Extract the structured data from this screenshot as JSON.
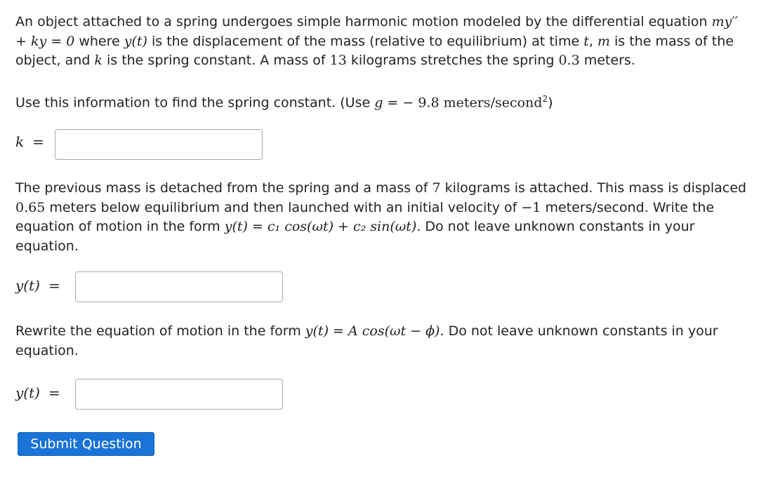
{
  "problem": {
    "intro": {
      "t1": "An object attached to a spring undergoes simple harmonic motion modeled by the differential equation",
      "eq1": "my′′ + ky = 0",
      "t2": " where ",
      "eq2": "y(t)",
      "t3": " is the displacement of the mass (relative to equilibrium) at time ",
      "eq3": "t",
      "t4": ", ",
      "eq4": "m",
      "t5": " is the mass of the object, and ",
      "eq5": "k",
      "t6": " is the spring constant. A mass of ",
      "num1": "13",
      "t7": " kilograms stretches the spring ",
      "num2": "0.3",
      "t8": " meters."
    },
    "part1": {
      "t1": "Use this information to find the spring constant. (Use ",
      "eq": "g",
      "t2": " = − 9.8 meters/second",
      "sup": "2",
      "t3": ")",
      "label": "k",
      "eqsign": "=",
      "value": ""
    },
    "part2": {
      "t1": "The previous mass is detached from the spring and a mass of ",
      "num1": "7",
      "t2": " kilograms is attached. This mass is displaced ",
      "num2": "0.65",
      "t3": " meters below equilibrium and then launched with an initial velocity of ",
      "num3": "−1",
      "t4": " meters/second. Write the equation of motion in the form ",
      "eq": "y(t) = c₁ cos(ωt) + c₂ sin(ωt)",
      "t5": ". Do not leave unknown constants in your equation.",
      "label": "y(t)",
      "eqsign": "=",
      "value": ""
    },
    "part3": {
      "t1": "Rewrite the equation of motion in the form ",
      "eq": "y(t) = A cos(ωt − ϕ)",
      "t2": ". Do not leave unknown constants in your equation.",
      "label": "y(t)",
      "eqsign": "=",
      "value": ""
    }
  },
  "submit_label": "Submit Question"
}
